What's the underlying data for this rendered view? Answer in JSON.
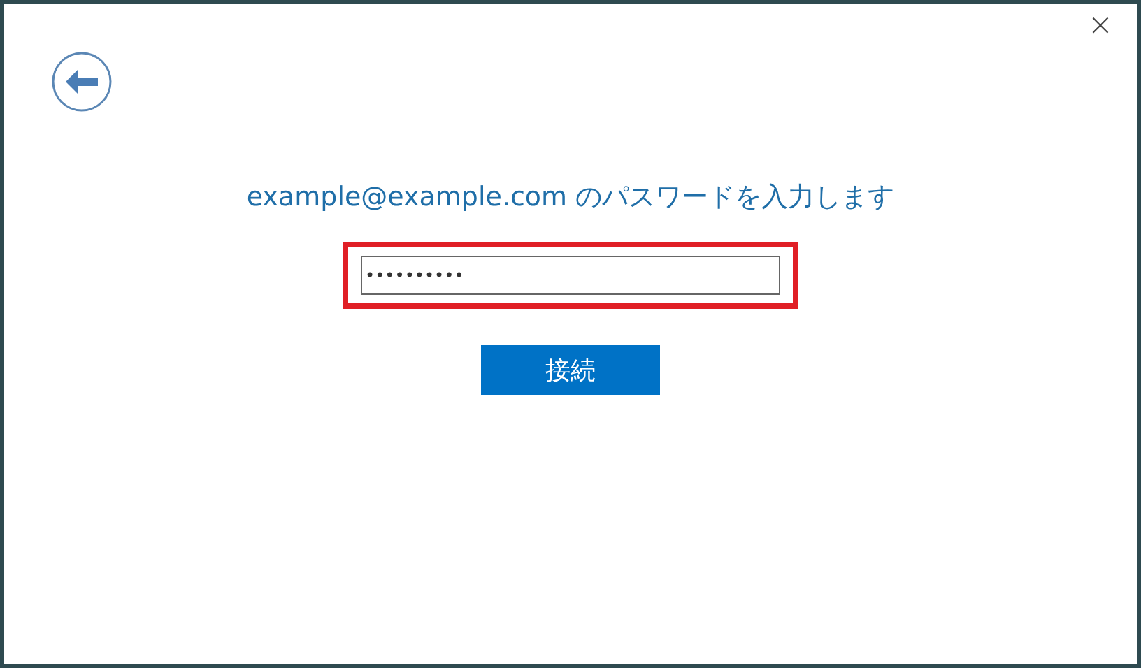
{
  "dialog": {
    "close": "×",
    "heading": "example@example.com のパスワードを入力します",
    "password_field": {
      "value": "••••••••••",
      "highlighted": true
    },
    "connect_button": "接続"
  }
}
